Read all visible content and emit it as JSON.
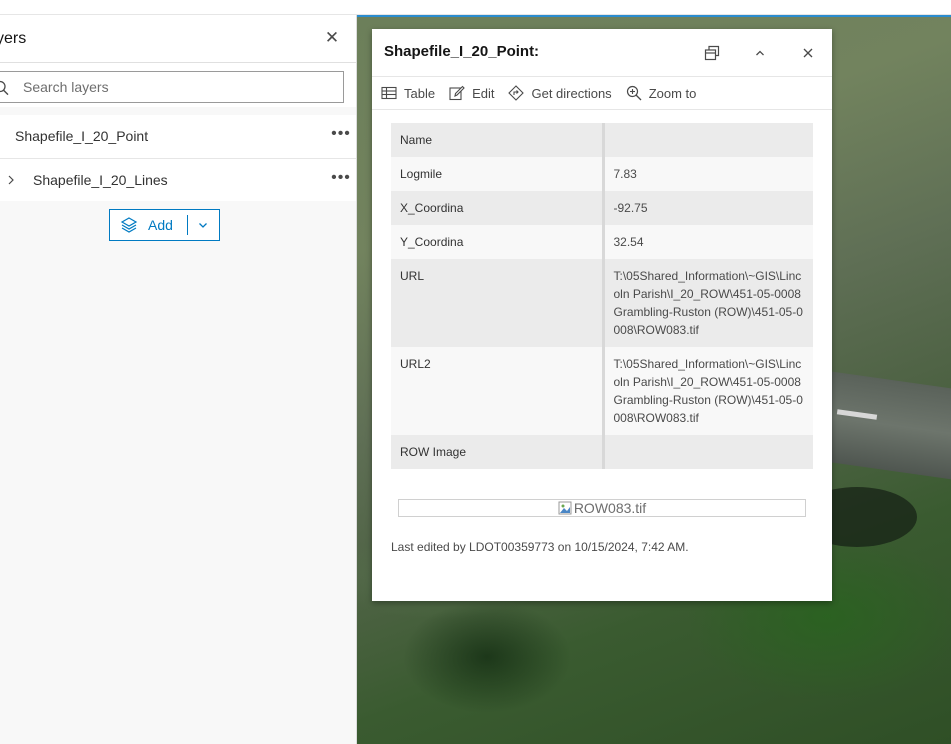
{
  "layers_panel": {
    "title": "yers",
    "search_placeholder": "Search layers",
    "layers": [
      {
        "name": "Shapefile_I_20_Point"
      },
      {
        "name": "Shapefile_I_20_Lines"
      }
    ],
    "add_label": "Add"
  },
  "popup": {
    "title": "Shapefile_I_20_Point:",
    "actions": {
      "table": "Table",
      "edit": "Edit",
      "directions": "Get directions",
      "zoom": "Zoom to"
    },
    "attributes": [
      {
        "key": "Name",
        "value": ""
      },
      {
        "key": "Logmile",
        "value": "7.83"
      },
      {
        "key": "X_Coordina",
        "value": "-92.75"
      },
      {
        "key": "Y_Coordina",
        "value": "32.54"
      },
      {
        "key": "URL",
        "value": "T:\\05Shared_Information\\~GIS\\Lincoln Parish\\I_20_ROW\\451-05-0008 Grambling-Ruston (ROW)\\451-05-0008\\ROW083.tif"
      },
      {
        "key": "URL2",
        "value": "T:\\05Shared_Information\\~GIS\\Lincoln Parish\\I_20_ROW\\451-05-0008 Grambling-Ruston (ROW)\\451-05-0008\\ROW083.tif"
      },
      {
        "key": "ROW Image",
        "value": ""
      }
    ],
    "image_alt": "ROW083.tif",
    "last_edited": "Last edited by LDOT00359773 on 10/15/2024, 7:42 AM."
  },
  "colors": {
    "accent": "#007ac2",
    "map_border": "#2a8ccf"
  }
}
